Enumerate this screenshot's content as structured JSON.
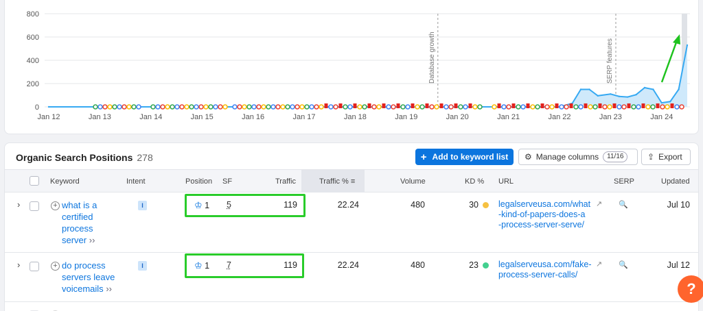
{
  "chart": {
    "y_ticks": [
      "800",
      "600",
      "400",
      "200",
      "0"
    ],
    "x_ticks": [
      "Jan 12",
      "Jan 13",
      "Jan 14",
      "Jan 15",
      "Jan 16",
      "Jan 17",
      "Jan 18",
      "Jan 19",
      "Jan 20",
      "Jan 21",
      "Jan 22",
      "Jan 23",
      "Jan 24"
    ],
    "annotations": [
      "Database growth",
      "SERP features"
    ],
    "colors": {
      "line": "#36a9f2",
      "fill": "#cfe9fb",
      "arrow": "#1ec21e",
      "marker_red": "#e3221d",
      "grid": "#e6e7ea"
    }
  },
  "chart_data": {
    "type": "area",
    "x": [
      "Jan 12",
      "Jan 13",
      "Jan 14",
      "Jan 15",
      "Jan 16",
      "Jan 17",
      "Jan 18",
      "Jan 19",
      "Jan 20",
      "Jan 21",
      "Jan 22",
      "2022-04",
      "2022-06",
      "2022-08",
      "2022-10",
      "Jan 23",
      "2023-03",
      "2023-05",
      "2023-07",
      "2023-09",
      "2023-11",
      "Jan 24",
      "2024-03",
      "2024-05",
      "2024-07"
    ],
    "y": [
      0,
      0,
      0,
      0,
      0,
      0,
      0,
      0,
      0,
      0,
      0,
      30,
      150,
      150,
      95,
      110,
      90,
      85,
      105,
      165,
      150,
      35,
      45,
      150,
      530
    ],
    "ylim": [
      0,
      800
    ],
    "grid": true,
    "title": "",
    "xlabel": "",
    "ylabel": ""
  },
  "table": {
    "title": "Organic Search Positions",
    "count": "278",
    "add_button": "Add to keyword list",
    "manage_button": "Manage columns",
    "manage_count": "11/16",
    "export_button": "Export",
    "columns": [
      "Keyword",
      "Intent",
      "Position",
      "SF",
      "Traffic",
      "Traffic %",
      "Volume",
      "KD %",
      "URL",
      "SERP",
      "Updated"
    ],
    "rows": [
      {
        "keyword": [
          "what is a",
          "certified",
          "process",
          "server"
        ],
        "intent": "I",
        "position": "1",
        "sf": "5",
        "traffic": "119",
        "traffic_pct": "22.24",
        "volume": "480",
        "kd": "30",
        "kd_color": "#f6c142",
        "url": [
          "legalserveusa.com/what",
          "-kind-of-papers-does-a",
          "-process-server-serve/"
        ],
        "updated": "Jul 10"
      },
      {
        "keyword": [
          "do process",
          "servers leave",
          "voicemails"
        ],
        "intent": "I",
        "position": "1",
        "sf": "7",
        "traffic": "119",
        "traffic_pct": "22.24",
        "volume": "480",
        "kd": "23",
        "kd_color": "#43d08f",
        "url": [
          "legalserveusa.com/fake-",
          "process-server-calls/"
        ],
        "updated": "Jul 12"
      }
    ]
  },
  "help": "?"
}
